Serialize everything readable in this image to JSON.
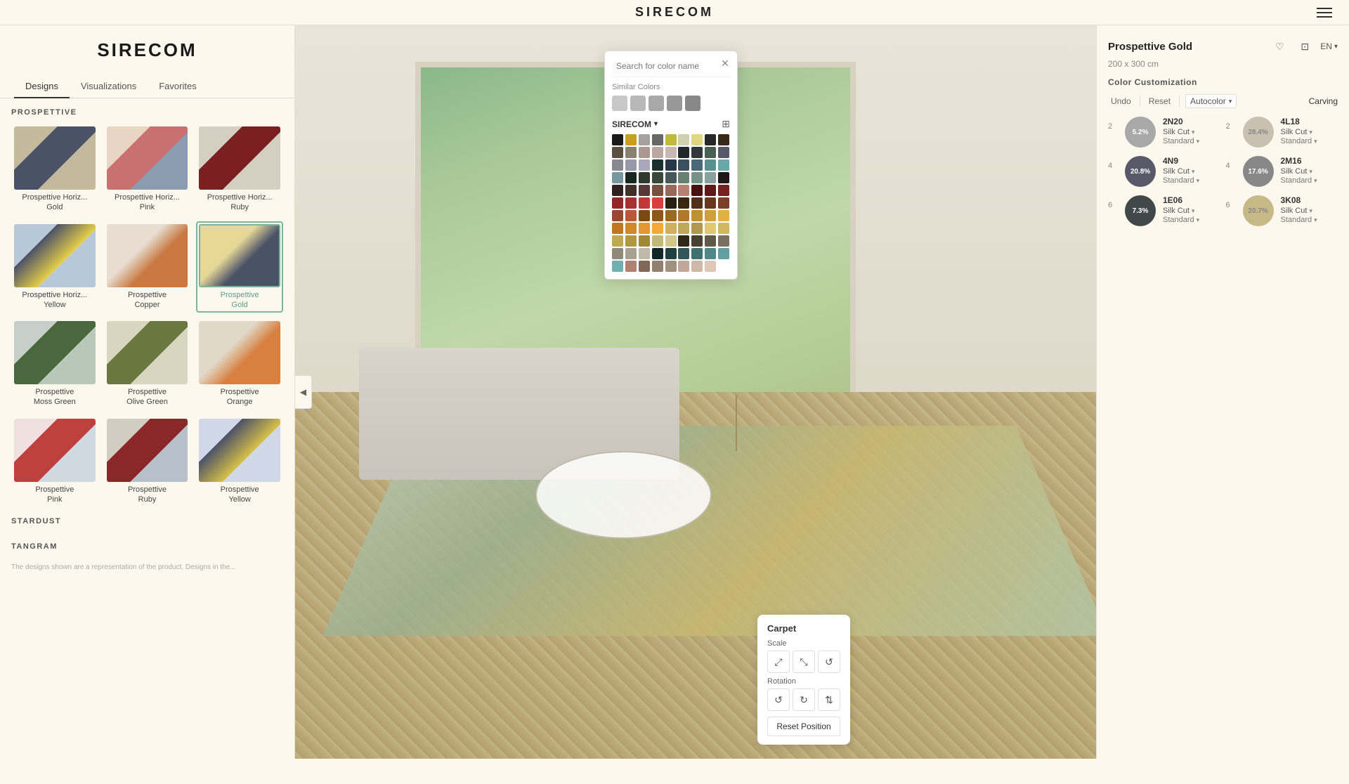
{
  "topbar": {
    "logo": "SIRECOM",
    "menu_icon": "≡"
  },
  "sidebar": {
    "logo": "SIRECOM",
    "tabs": [
      {
        "label": "Designs",
        "active": true
      },
      {
        "label": "Visualizations",
        "active": false
      },
      {
        "label": "Favorites",
        "active": false
      }
    ],
    "sections": [
      {
        "title": "PROSPETTIVE",
        "items": [
          {
            "label": "Prospettive Horiz...\nGold",
            "label1": "Prospettive Horiz...",
            "label2": "Gold",
            "thumb_class": "thumb-prospettive-gold",
            "active": false
          },
          {
            "label": "Prospettive Horiz...\nPink",
            "label1": "Prospettive Horiz...",
            "label2": "Pink",
            "thumb_class": "thumb-prospettive-pink",
            "active": false
          },
          {
            "label": "Prospettive Horiz...\nRuby",
            "label1": "Prospettive Horiz...",
            "label2": "Ruby",
            "thumb_class": "thumb-prospettive-ruby",
            "active": false
          },
          {
            "label": "Prospettive Horiz...\nYellow",
            "label1": "Prospettive Horiz...",
            "label2": "Yellow",
            "thumb_class": "thumb-prospettive-yellow",
            "active": false
          },
          {
            "label": "Prospettive\nCopper",
            "label1": "Prospettive",
            "label2": "Copper",
            "thumb_class": "thumb-prospettive-copper",
            "active": false
          },
          {
            "label": "Prospettive\nGold",
            "label1": "Prospettive",
            "label2": "Gold",
            "thumb_class": "thumb-prospettive-gold2",
            "active": true
          },
          {
            "label": "Prospettive\nMoss Green",
            "label1": "Prospettive",
            "label2": "Moss Green",
            "thumb_class": "thumb-prospettive-mossgreen",
            "active": false
          },
          {
            "label": "Prospettive\nOlive Green",
            "label1": "Prospettive",
            "label2": "Olive Green",
            "thumb_class": "thumb-prospettive-olivegreen",
            "active": false
          },
          {
            "label": "Prospettive\nOrange",
            "label1": "Prospettive",
            "label2": "Orange",
            "thumb_class": "thumb-prospettive-orange",
            "active": false
          },
          {
            "label": "Prospettive\nPink",
            "label1": "Prospettive",
            "label2": "Pink",
            "thumb_class": "thumb-prospettive-pink2",
            "active": false
          },
          {
            "label": "Prospettive\nRuby",
            "label1": "Prospettive",
            "label2": "Ruby",
            "thumb_class": "thumb-prospettive-ruby2",
            "active": false
          },
          {
            "label": "Prospettive\nYellow",
            "label1": "Prospettive",
            "label2": "Yellow",
            "thumb_class": "thumb-prospettive-yellow2",
            "active": false
          }
        ]
      },
      {
        "title": "STARDUST",
        "items": []
      },
      {
        "title": "TANGRAM",
        "items": []
      }
    ]
  },
  "color_picker": {
    "search_placeholder": "Search for color name",
    "similar_colors_label": "Similar Colors",
    "similar_swatches": [
      {
        "color": "#c8c8c8"
      },
      {
        "color": "#b8b8b8"
      },
      {
        "color": "#a8a8a8"
      },
      {
        "color": "#989898"
      },
      {
        "color": "#888888"
      }
    ],
    "brand": "SIRECOM",
    "palette_colors": [
      "#1a1a1a",
      "#c8a020",
      "#a8a0a0",
      "#686868",
      "#c0b840",
      "#d0d0b0",
      "#e0d880",
      "#282828",
      "#382818",
      "#5a5040",
      "#888070",
      "#a89890",
      "#b8a8a0",
      "#c8b8b0",
      "#202828",
      "#303838",
      "#486050",
      "#585868",
      "#888890",
      "#9898a8",
      "#a8a8b8",
      "#183030",
      "#283848",
      "#385060",
      "#486878",
      "#589090",
      "#68a8a8",
      "#7898a0",
      "#182820",
      "#303830",
      "#384838",
      "#485858",
      "#688070",
      "#789088",
      "#88a0a0",
      "#201818",
      "#302020",
      "#403028",
      "#583838",
      "#785040",
      "#986858",
      "#b88070",
      "#481010",
      "#601818",
      "#782020",
      "#902828",
      "#a83030",
      "#c03838",
      "#d84040",
      "#282010",
      "#382810",
      "#503018",
      "#683820",
      "#784028",
      "#984830",
      "#b85838",
      "#7a4a10",
      "#8a5818",
      "#9a6820",
      "#b07828",
      "#c09030",
      "#d0a038",
      "#e0b040",
      "#c07820",
      "#d08828",
      "#e09830",
      "#f0a838",
      "#d0b060",
      "#c0a858",
      "#b09850",
      "#e0c870",
      "#d0b860",
      "#c0a850",
      "#b09840",
      "#a08838",
      "#c0b878",
      "#d0c888",
      "#302818",
      "#484030",
      "#605848",
      "#787060",
      "#908878",
      "#a8a090",
      "#c0b8a8",
      "#102828",
      "#204040",
      "#305858",
      "#407070",
      "#508888",
      "#60a0a0",
      "#70b0b0",
      "#b08070",
      "#806858",
      "#908070",
      "#a09080",
      "#c0a898",
      "#d0b8a8",
      "#e0c8b8"
    ]
  },
  "right_panel": {
    "title": "Prospettive Gold",
    "size": "200 x 300 cm",
    "section_label": "Color Customization",
    "toolbar": {
      "undo_label": "Undo",
      "reset_label": "Reset",
      "autocolor_label": "Autocolor",
      "carving_label": "Carving"
    },
    "lang": "EN",
    "color_entries": [
      {
        "number": "2",
        "code": "2N20",
        "cut": "Silk Cut",
        "standard": "Standard",
        "pct": "5.2%",
        "swatch_color": "#a8a8a8"
      },
      {
        "number": "2",
        "code": "4L18",
        "cut": "Silk Cut",
        "standard": "Standard",
        "pct": "28.4%",
        "swatch_color": "#c8c0b0"
      },
      {
        "number": "4",
        "code": "4N9",
        "cut": "Silk Cut",
        "standard": "Standard",
        "pct": "20.8%",
        "swatch_color": "#585868"
      },
      {
        "number": "4",
        "code": "2M16",
        "cut": "Silk Cut",
        "standard": "Standard",
        "pct": "17.6%",
        "swatch_color": "#888888"
      },
      {
        "number": "6",
        "code": "1E06",
        "cut": "Silk Cut",
        "standard": "Standard",
        "pct": "7.3%",
        "swatch_color": "#484848"
      },
      {
        "number": "6",
        "code": "3K08",
        "cut": "Silk Cut",
        "standard": "Standard",
        "pct": "20.7%",
        "swatch_color": "#c8b888"
      }
    ]
  },
  "carpet_control": {
    "title": "Carpet",
    "scale_label": "Scale",
    "rotation_label": "Rotation",
    "reset_label": "Reset Position",
    "scale_btns": [
      "↗",
      "↙",
      "↺"
    ],
    "rotation_btns": [
      "↺",
      "↻",
      "↕"
    ]
  }
}
